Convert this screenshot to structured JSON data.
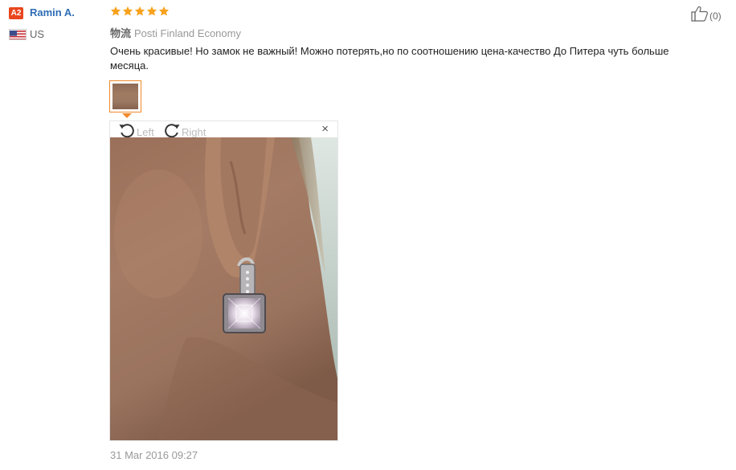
{
  "reviewer": {
    "level_badge": "A2",
    "name": "Ramin A.",
    "country": "US",
    "flag_icon": "us-flag-icon"
  },
  "rating": {
    "stars": 5,
    "max": 5,
    "color": "#f7a21e"
  },
  "shipping": {
    "label": "物流",
    "method": "Posti Finland Economy"
  },
  "review": {
    "text": "Очень красивые! Но замок не важный! Можно потерять,но по соотношению цена-качество До Питера чуть больше месяца."
  },
  "likes": {
    "count": "(0)",
    "icon": "thumbs-up-icon"
  },
  "viewer": {
    "rotate_left": "Left",
    "rotate_right": "Right",
    "close": "×"
  },
  "date": "31 Mar 2016 09:27",
  "colors": {
    "username": "#2d6cb5",
    "badge": "#e8461e",
    "thumb_border": "#f08a2c",
    "meta_text": "#999999"
  }
}
